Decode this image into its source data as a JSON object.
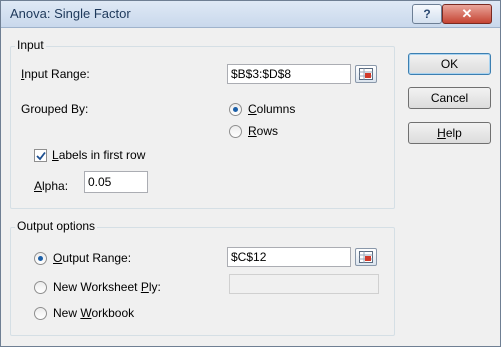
{
  "window": {
    "title": "Anova: Single Factor"
  },
  "titlebar": {
    "help_glyph": "?",
    "close_glyph": "✕"
  },
  "input": {
    "legend": "Input",
    "input_range_label_u": "I",
    "input_range_label_rest": "nput Range:",
    "input_range_value": "$B$3:$D$8",
    "grouped_by_label": "Grouped By:",
    "columns_u": "C",
    "columns_rest": "olumns",
    "rows_u": "R",
    "rows_rest": "ows",
    "labels_u": "L",
    "labels_rest": "abels in first row",
    "alpha_u": "A",
    "alpha_rest": "lpha:",
    "alpha_value": "0.05"
  },
  "output": {
    "legend": "Output options",
    "output_range_u": "O",
    "output_range_rest": "utput Range:",
    "output_range_value": "$C$12",
    "new_ply_pre": "New Worksheet ",
    "new_ply_u": "P",
    "new_ply_post": "ly:",
    "new_ply_value": "",
    "new_wb_pre": "New ",
    "new_wb_u": "W",
    "new_wb_post": "orkbook"
  },
  "buttons": {
    "ok": "OK",
    "cancel": "Cancel",
    "help_u": "H",
    "help_rest": "elp"
  },
  "icons": {
    "ref_button": "range-select-icon",
    "help": "help-icon",
    "close": "close-icon"
  },
  "state": {
    "grouped_by": "columns",
    "labels_in_first_row": true,
    "output_choice": "output-range"
  }
}
